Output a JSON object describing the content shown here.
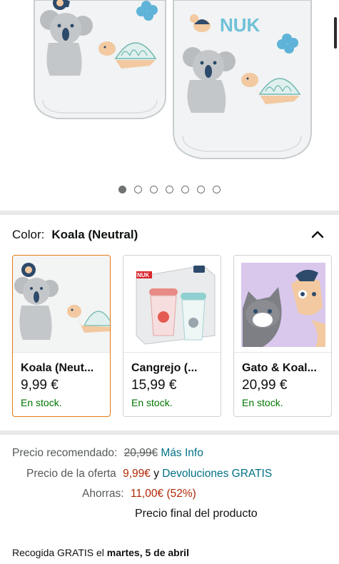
{
  "product": {
    "brand_text": "NUK",
    "gallery": {
      "image_count": 7,
      "active_index": 0
    }
  },
  "color": {
    "label": "Color:",
    "selected_value": "Koala (Neutral)",
    "variants": [
      {
        "name": "Koala (Neut...",
        "price": "9,99 €",
        "stock": "En stock.",
        "selected": true
      },
      {
        "name": "Cangrejo (...",
        "price": "15,99 €",
        "stock": "En stock.",
        "selected": false
      },
      {
        "name": "Gato & Koal...",
        "price": "20,99 €",
        "stock": "En stock.",
        "selected": false
      }
    ]
  },
  "pricing": {
    "recommended_label": "Precio recomendado:",
    "recommended_value": "20,99€",
    "more_info_link": "Más Info",
    "offer_label": "Precio de la oferta",
    "offer_value": "9,99€",
    "offer_connector": "y",
    "returns_link": "Devoluciones GRATIS",
    "savings_label": "Ahorras:",
    "savings_value": "11,00€ (52%)",
    "final_note": "Precio final del producto"
  },
  "pickup": {
    "prefix": "Recogida GRATIS el",
    "date": "martes, 5 de abril"
  },
  "colors": {
    "link": "#007185",
    "price_red": "#b12704",
    "in_stock_green": "#007600",
    "selected_border": "#e47911"
  }
}
